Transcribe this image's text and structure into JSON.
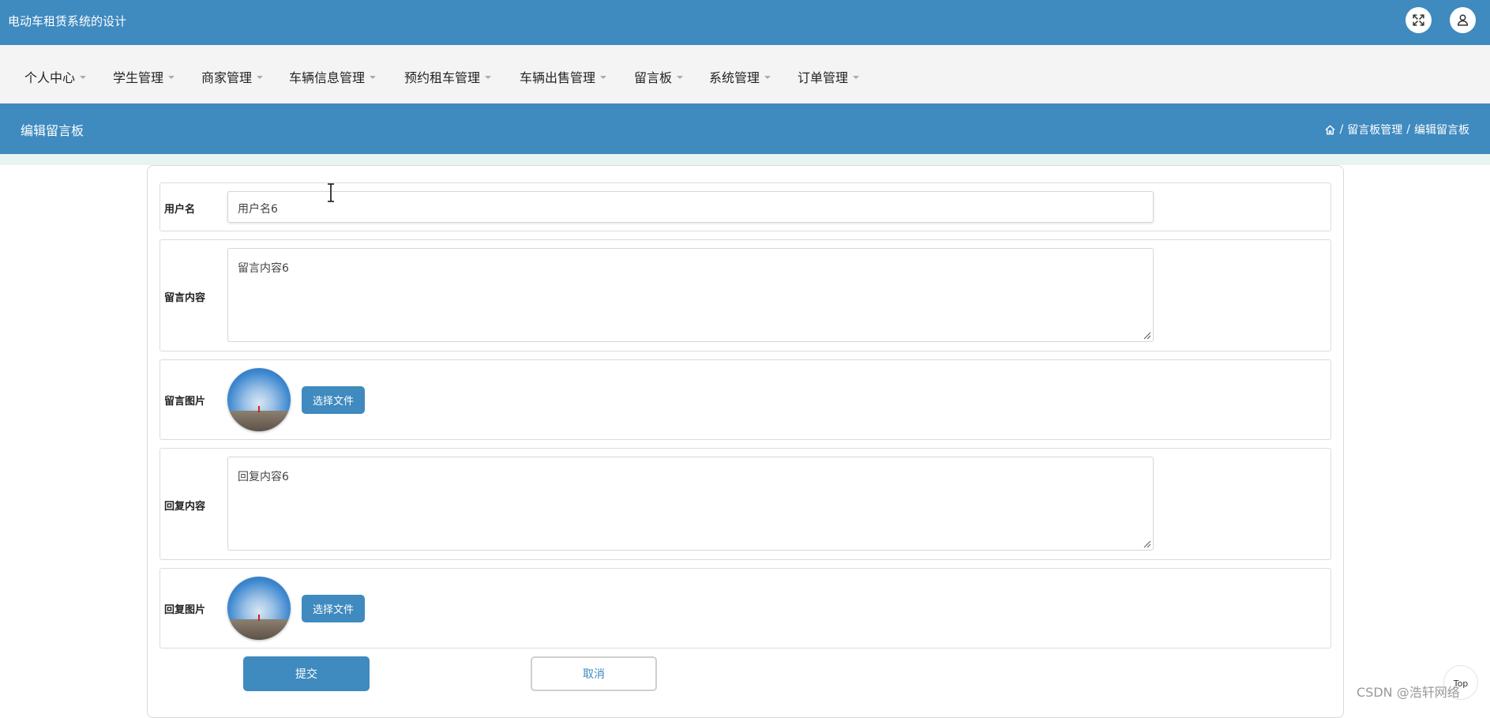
{
  "app": {
    "title": "电动车租赁系统的设计",
    "fullscreen_icon": "fullscreen-icon",
    "user_icon": "user-icon"
  },
  "menu": {
    "items": [
      {
        "label": "个人中心"
      },
      {
        "label": "学生管理"
      },
      {
        "label": "商家管理"
      },
      {
        "label": "车辆信息管理"
      },
      {
        "label": "预约租车管理"
      },
      {
        "label": "车辆出售管理"
      },
      {
        "label": "留言板"
      },
      {
        "label": "系统管理"
      },
      {
        "label": "订单管理"
      }
    ]
  },
  "page": {
    "title": "编辑留言板",
    "breadcrumb": {
      "home_icon": "home-icon",
      "separator": "/",
      "items": [
        "留言板管理",
        "编辑留言板"
      ]
    }
  },
  "form": {
    "username": {
      "label": "用户名",
      "value": "用户名6"
    },
    "message_content": {
      "label": "留言内容",
      "value": "留言内容6"
    },
    "message_image": {
      "label": "留言图片",
      "button": "选择文件"
    },
    "reply_content": {
      "label": "回复内容",
      "value": "回复内容6"
    },
    "reply_image": {
      "label": "回复图片",
      "button": "选择文件"
    },
    "submit_label": "提交",
    "cancel_label": "取消"
  },
  "misc": {
    "top_label": "Top",
    "watermark": "CSDN @浩轩网络"
  },
  "colors": {
    "primary": "#3f8abf",
    "menu_bg": "#f4f4f4"
  }
}
